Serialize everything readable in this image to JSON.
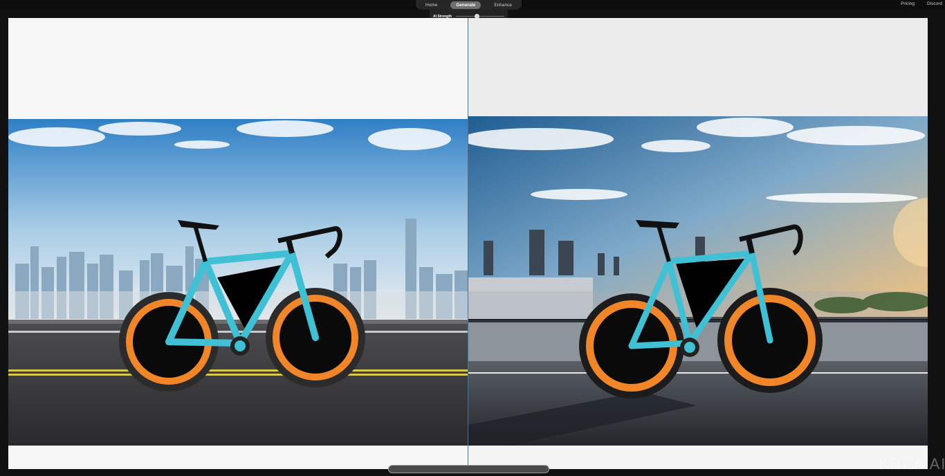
{
  "nav": {
    "items": [
      {
        "label": "Home",
        "active": false
      },
      {
        "label": "Generate",
        "active": true
      },
      {
        "label": "Enhance",
        "active": false
      }
    ],
    "right_links": [
      "Pricing",
      "Discord"
    ]
  },
  "strength": {
    "label": "AI Strength",
    "value_fraction": 0.43
  },
  "watermark": "KREA AI",
  "colors": {
    "bike_frame": "#3fc0d4",
    "wheel_rim": "#f08628",
    "background": "#111111"
  }
}
